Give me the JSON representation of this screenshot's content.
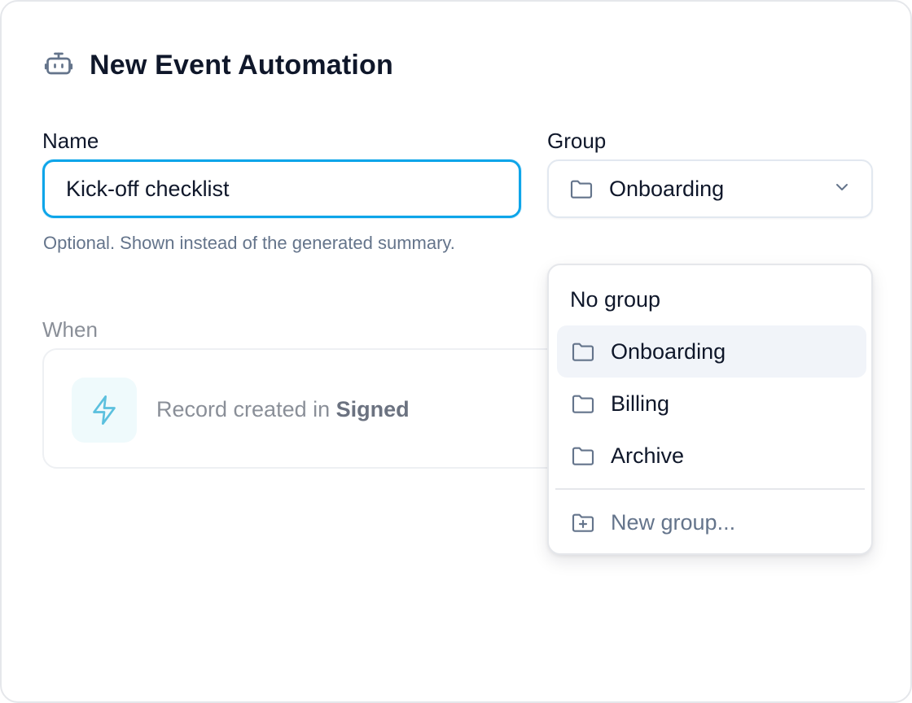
{
  "header": {
    "title": "New Event Automation",
    "icon": "robot-icon"
  },
  "name_field": {
    "label": "Name",
    "value": "Kick-off checklist",
    "helper": "Optional. Shown instead of the generated summary."
  },
  "group_field": {
    "label": "Group",
    "selected": "Onboarding",
    "icon": "folder-icon"
  },
  "group_dropdown": {
    "no_group": "No group",
    "options": [
      {
        "label": "Onboarding",
        "active": true
      },
      {
        "label": "Billing",
        "active": false
      },
      {
        "label": "Archive",
        "active": false
      }
    ],
    "new_group": "New group..."
  },
  "when": {
    "label": "When",
    "trigger_prefix": "Record created in ",
    "trigger_target": "Signed",
    "icon": "bolt-icon"
  },
  "colors": {
    "accent": "#0ea5e9",
    "text": "#0f172a",
    "muted": "#64748b",
    "active_bg": "#f1f4f9",
    "bolt": "#5bc0de"
  }
}
